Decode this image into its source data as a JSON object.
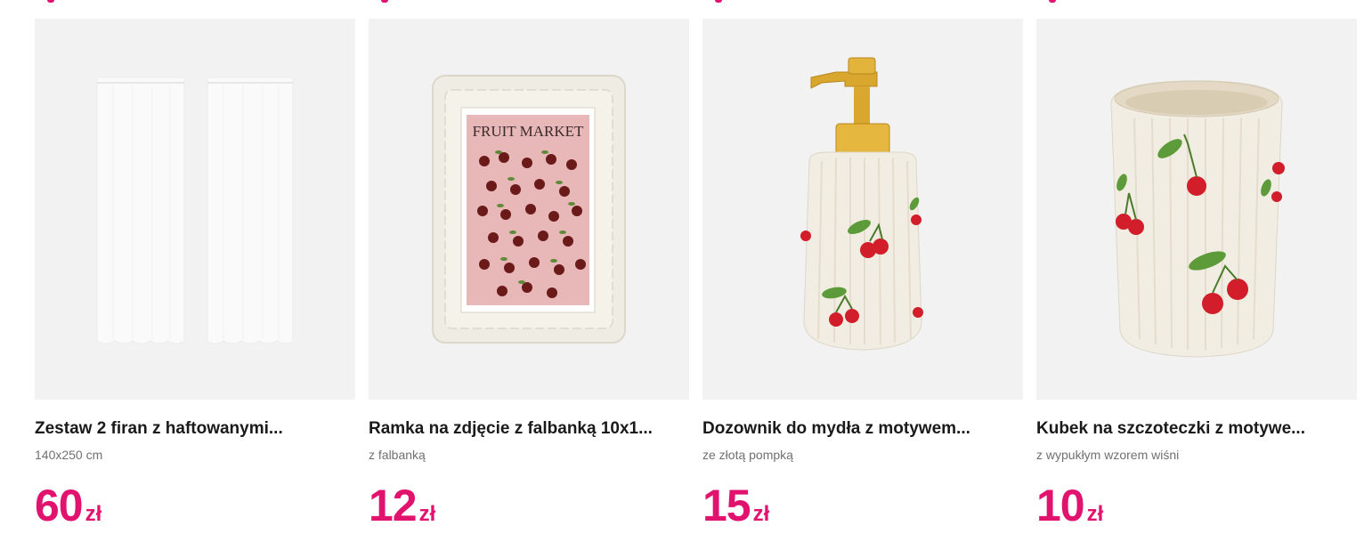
{
  "products": [
    {
      "image_icon": "curtains-image",
      "title": "Zestaw 2 firan z haftowanymi...",
      "subtitle": "140x250 cm",
      "price": "60",
      "currency": "zł"
    },
    {
      "image_icon": "photo-frame-image",
      "image_text": "FRUIT MARKET",
      "title": "Ramka na zdjęcie z falbanką 10x1...",
      "subtitle": "z falbanką",
      "price": "12",
      "currency": "zł"
    },
    {
      "image_icon": "soap-dispenser-image",
      "title": "Dozownik do mydła z motywem...",
      "subtitle": "ze złotą pompką",
      "price": "15",
      "currency": "zł"
    },
    {
      "image_icon": "toothbrush-cup-image",
      "title": "Kubek na szczoteczki z motywe...",
      "subtitle": "z wypukłym wzorem wiśni",
      "price": "10",
      "currency": "zł"
    }
  ],
  "colors": {
    "accent": "#e2136e",
    "image_bg": "#f2f2f2",
    "title": "#1a1a1a",
    "subtitle": "#707070"
  }
}
